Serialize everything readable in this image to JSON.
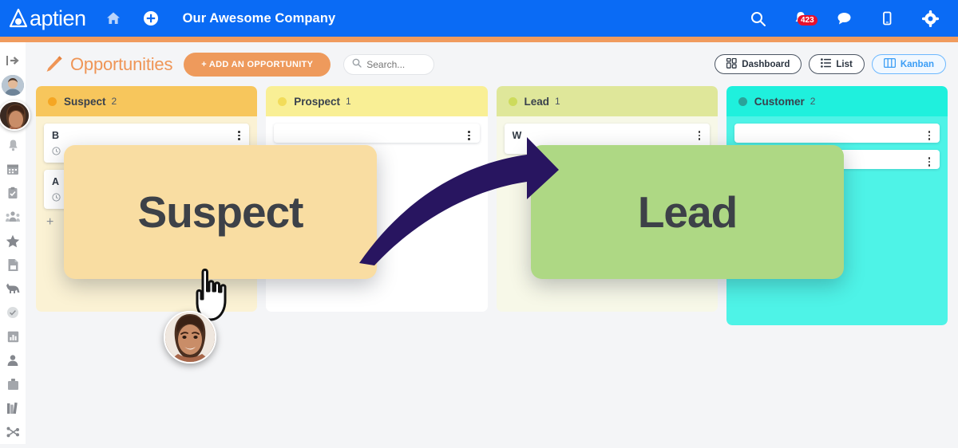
{
  "app": {
    "logo_text": "aptien",
    "company_name": "Our Awesome Company",
    "brand_blue": "#0a6bf5",
    "brand_orange": "#ee9a5c"
  },
  "topbar": {
    "home_icon": "home-icon",
    "add_icon": "plus-circle-icon",
    "search_icon": "search-icon",
    "bell_icon": "bell-icon",
    "notification_count": "423",
    "chat_icon": "chat-bubble-icon",
    "mobile_icon": "mobile-device-icon",
    "settings_icon": "gear-icon"
  },
  "sidebar": {
    "items": [
      {
        "name": "expand-sidebar",
        "icon": "arrow-right-bar-icon"
      },
      {
        "name": "user-avatar-1",
        "icon": "avatar"
      },
      {
        "name": "user-avatar-2",
        "icon": "avatar"
      },
      {
        "name": "notifications",
        "icon": "bell-icon"
      },
      {
        "name": "calendar",
        "icon": "calendar-icon"
      },
      {
        "name": "tasks",
        "icon": "clipboard-check-icon"
      },
      {
        "name": "team",
        "icon": "people-icon"
      },
      {
        "name": "favorites",
        "icon": "star-icon"
      },
      {
        "name": "documents",
        "icon": "document-icon"
      },
      {
        "name": "assets",
        "icon": "dog-icon"
      },
      {
        "name": "approvals",
        "icon": "check-circle-icon"
      },
      {
        "name": "reports",
        "icon": "bar-chart-icon"
      },
      {
        "name": "contacts",
        "icon": "person-icon"
      },
      {
        "name": "equipment",
        "icon": "briefcase-icon"
      },
      {
        "name": "library",
        "icon": "books-icon"
      },
      {
        "name": "workflow",
        "icon": "network-icon"
      }
    ]
  },
  "toolbar": {
    "pencil_icon": "pencil-icon",
    "title": "Opportunities",
    "add_button": "+ ADD AN OPPORTUNITY",
    "search_placeholder": "Search...",
    "views": [
      {
        "label": "Dashboard",
        "icon": "grid-icon",
        "active": false
      },
      {
        "label": "List",
        "icon": "list-icon",
        "active": false
      },
      {
        "label": "Kanban",
        "icon": "columns-icon",
        "active": true
      }
    ]
  },
  "board": {
    "columns": [
      {
        "name": "Suspect",
        "count": "2",
        "dot_color": "#f5a623",
        "header_color": "#f7c65c",
        "body_color": "#fbf2d4",
        "cards": [
          {
            "title": "B",
            "sub": ""
          },
          {
            "title": "A",
            "sub": ""
          }
        ],
        "add_card": "+"
      },
      {
        "name": "Prospect",
        "count": "1",
        "dot_color": "#f2dc5a",
        "header_color": "#f9ef95",
        "body_color": "#ffffff",
        "cards": [
          {
            "title": "",
            "sub": ""
          }
        ],
        "add_card": "+"
      },
      {
        "name": "Lead",
        "count": "1",
        "dot_color": "#cddb5c",
        "header_color": "#dfe79a",
        "body_color": "#f7f8e8",
        "cards": [
          {
            "title": "W",
            "sub": ""
          }
        ],
        "add_card": "+"
      },
      {
        "name": "Customer",
        "count": "2",
        "dot_color": "#2aa39a",
        "header_color": "#1ff0dd",
        "body_color": "#4ef3e7",
        "cards": [
          {
            "title": "",
            "sub": ""
          },
          {
            "title": "",
            "sub": ""
          }
        ],
        "add_card": "+"
      }
    ]
  },
  "annotation": {
    "from_label": "Suspect",
    "to_label": "Lead",
    "from_tile_color": "#f9dda2",
    "to_tile_color": "#aed884",
    "arrow_color": "#281560",
    "cursor_icon": "pointing-hand-cursor",
    "dragged_avatar": "avatar"
  }
}
